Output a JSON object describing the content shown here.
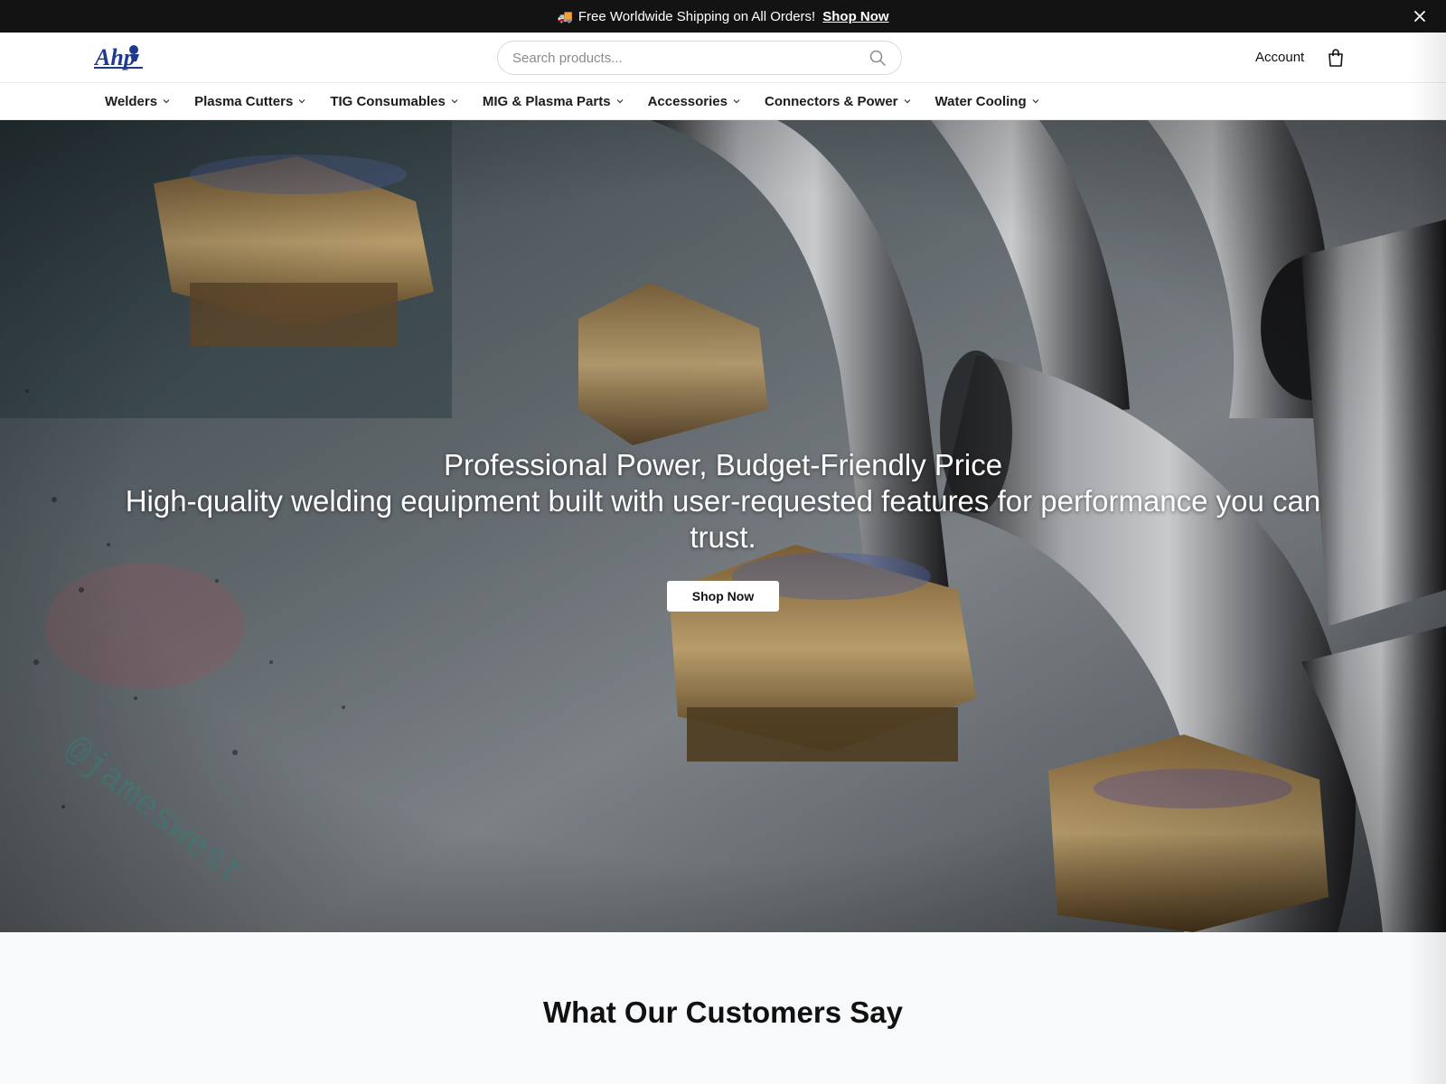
{
  "announcement": {
    "icon": "truck-icon",
    "emoji": "🚚",
    "text": "Free Worldwide Shipping on All Orders!",
    "link": "Shop Now"
  },
  "header": {
    "logo_text": "Ahp",
    "search_placeholder": "Search products...",
    "account_label": "Account"
  },
  "nav": {
    "items": [
      {
        "label": "Welders"
      },
      {
        "label": "Plasma Cutters"
      },
      {
        "label": "TIG Consumables"
      },
      {
        "label": "MIG & Plasma Parts"
      },
      {
        "label": "Accessories"
      },
      {
        "label": "Connectors & Power"
      },
      {
        "label": "Water Cooling"
      }
    ]
  },
  "hero": {
    "title": "Professional Power, Budget-Friendly Price",
    "subtitle": "High-quality welding equipment built with user-requested features for performance you can trust.",
    "button": "Shop Now"
  },
  "testimonials": {
    "title": "What Our Customers Say"
  },
  "colors": {
    "announcement_bg": "#131313",
    "logo_blue": "#1e3a8a",
    "text_dark": "#111111"
  }
}
